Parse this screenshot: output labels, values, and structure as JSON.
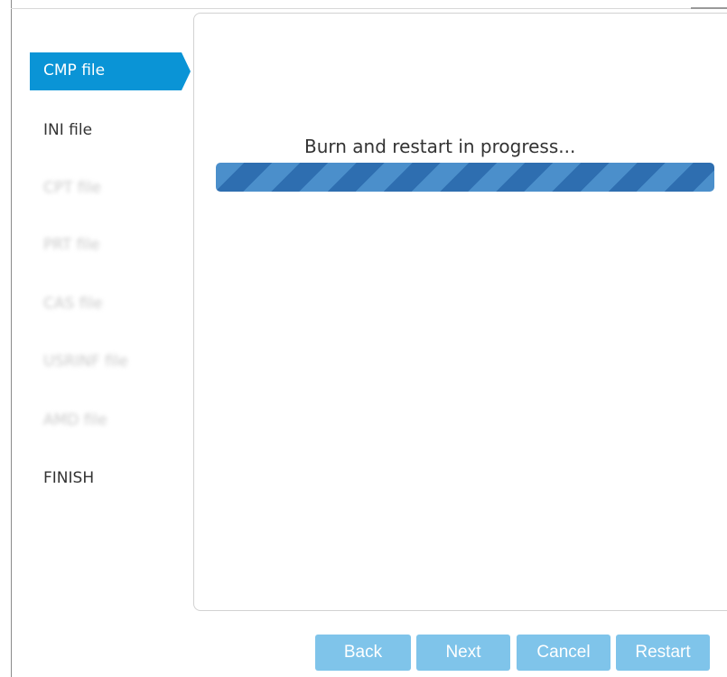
{
  "wizard": {
    "steps": [
      {
        "label": "CMP file",
        "state": "active"
      },
      {
        "label": "INI file",
        "state": "normal"
      },
      {
        "label": "CPT file",
        "state": "blurred"
      },
      {
        "label": "PRT file",
        "state": "blurred"
      },
      {
        "label": "CAS file",
        "state": "blurred"
      },
      {
        "label": "USRINF file",
        "state": "blurred"
      },
      {
        "label": "AMD file",
        "state": "blurred"
      },
      {
        "label": "FINISH",
        "state": "normal"
      }
    ],
    "active_color": "#0a94d6"
  },
  "main": {
    "progress_text": "Burn and restart in progress...",
    "progress_value": 1.0
  },
  "buttons": {
    "back": "Back",
    "next": "Next",
    "cancel": "Cancel",
    "restart": "Restart",
    "color": "#7fc4ea"
  }
}
